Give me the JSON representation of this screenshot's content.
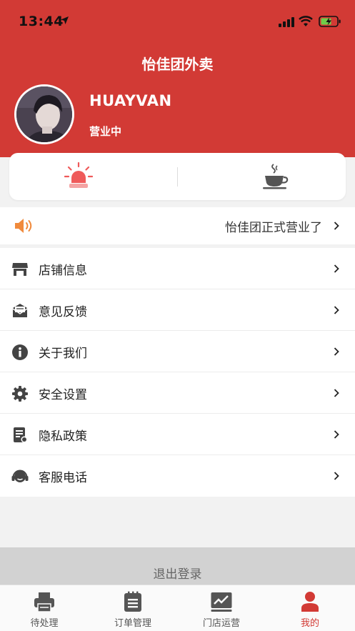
{
  "status_bar": {
    "time": "13:44"
  },
  "app": {
    "title": "怡佳团外卖"
  },
  "profile": {
    "username": "HUAYVAN",
    "status": "营业中"
  },
  "actions": [
    {
      "icon": "alarm-light-icon"
    },
    {
      "icon": "coffee-cup-icon"
    }
  ],
  "notice": {
    "icon": "speaker-icon",
    "text": "怡佳团正式营业了"
  },
  "menu": [
    {
      "icon": "store-icon",
      "label": "店铺信息"
    },
    {
      "icon": "feedback-mail-icon",
      "label": "意见反馈"
    },
    {
      "icon": "info-icon",
      "label": "关于我们"
    },
    {
      "icon": "gear-icon",
      "label": "安全设置"
    },
    {
      "icon": "document-icon",
      "label": "隐私政策"
    },
    {
      "icon": "headset-icon",
      "label": "客服电话"
    }
  ],
  "logout": {
    "label": "退出登录"
  },
  "tabs": [
    {
      "icon": "printer-icon",
      "label": "待处理"
    },
    {
      "icon": "clipboard-icon",
      "label": "订单管理"
    },
    {
      "icon": "chart-icon",
      "label": "门店运营"
    },
    {
      "icon": "person-icon",
      "label": "我的"
    }
  ],
  "colors": {
    "brand": "#d23a35",
    "alarm": "#ef5a5a",
    "speaker": "#f08a3c"
  }
}
